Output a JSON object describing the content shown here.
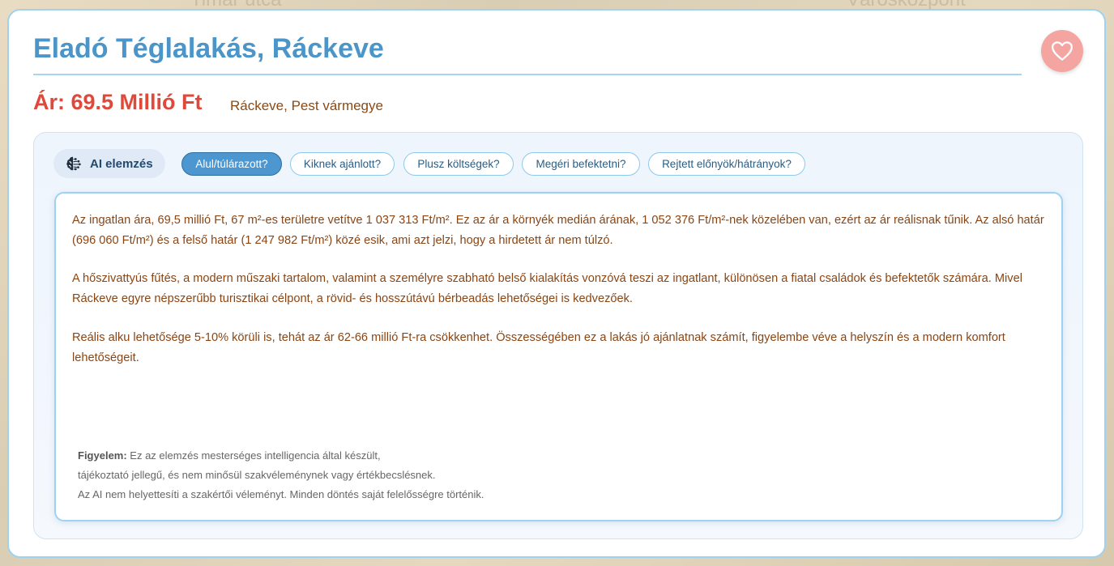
{
  "listing": {
    "title": "Eladó Téglalakás, Ráckeve",
    "price": "Ár: 69.5 Millió Ft",
    "location": "Ráckeve, Pest vármegye",
    "favorite_icon": "heart-icon"
  },
  "ai": {
    "label": "AI elemzés",
    "icon": "brain-icon",
    "tabs": [
      {
        "label": "Alul/túlárazott?",
        "active": true
      },
      {
        "label": "Kiknek ajánlott?",
        "active": false
      },
      {
        "label": "Plusz költségek?",
        "active": false
      },
      {
        "label": "Megéri befektetni?",
        "active": false
      },
      {
        "label": "Rejtett előnyök/hátrányok?",
        "active": false
      }
    ],
    "paragraphs": [
      "Az ingatlan ára, 69,5 millió Ft, 67 m²-es területre vetítve 1 037 313 Ft/m². Ez az ár a környék medián árának, 1 052 376 Ft/m²-nek közelében van, ezért az ár reálisnak tűnik. Az alsó határ (696 060 Ft/m²) és a felső határ (1 247 982 Ft/m²) közé esik, ami azt jelzi, hogy a hirdetett ár nem túlzó.",
      "A hőszivattyús fűtés, a modern műszaki tartalom, valamint a személyre szabható belső kialakítás vonzóvá teszi az ingatlant, különösen a fiatal családok és befektetők számára. Mivel Ráckeve egyre népszerűbb turisztikai célpont, a rövid- és hosszútávú bérbeadás lehetőségei is kedvezőek.",
      "Reális alku lehetősége 5-10% körüli is, tehát az ár 62-66 millió Ft-ra csökkenhet. Összességében ez a lakás jó ajánlatnak számít, figyelembe véve a helyszín és a modern komfort lehetőségeit."
    ],
    "disclaimer": {
      "bold": "Figyelem:",
      "line1": " Ez az elemzés mesterséges intelligencia által készült,",
      "line2": "tájékoztató jellegű, és nem minősül szakvéleménynek vagy értékbecslésnek.",
      "line3": "Az AI nem helyettesíti a szakértői véleményt. Minden döntés saját felelősségre történik."
    }
  },
  "background": {
    "map_labels": [
      "Timár utca",
      "Városközpont"
    ]
  },
  "colors": {
    "title": "#4b95c9",
    "price": "#e0483a",
    "body_text": "#8b4513",
    "accent": "#4d97d1",
    "favorite": "#f4a5a1"
  }
}
